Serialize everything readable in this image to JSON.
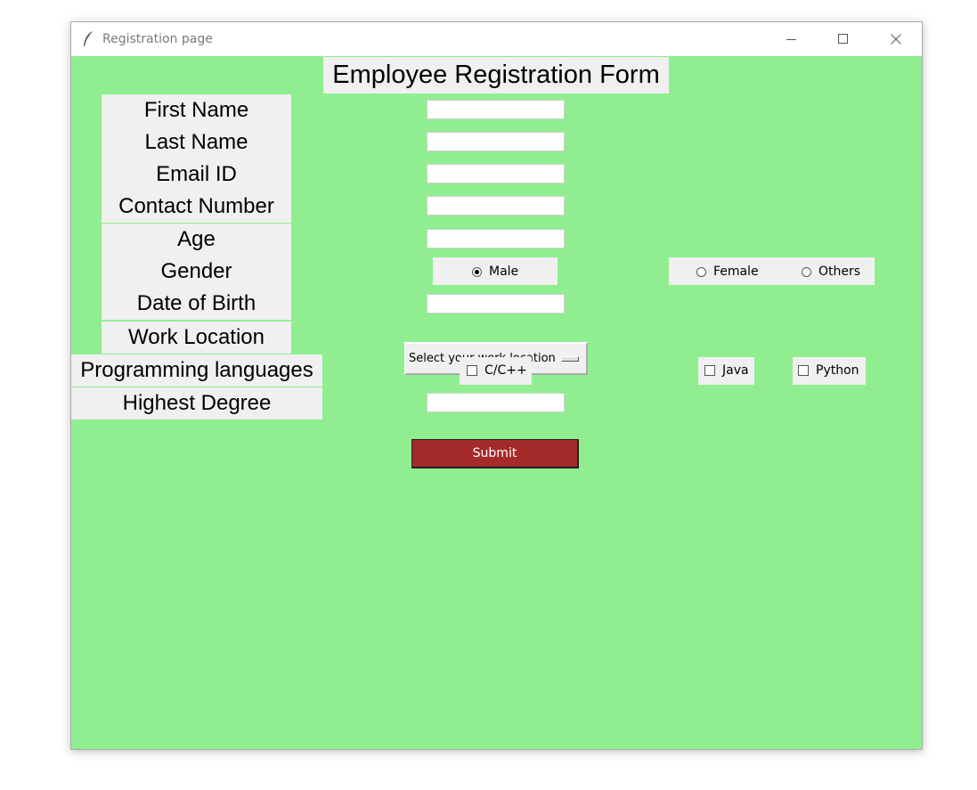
{
  "window": {
    "title": "Registration page",
    "icon": "feather-icon",
    "controls": [
      "minimize-icon",
      "maximize-icon",
      "close-icon"
    ]
  },
  "form": {
    "heading": "Employee Registration Form",
    "labels": {
      "first_name": "First Name",
      "last_name": "Last Name",
      "email": "Email ID",
      "contact": "Contact Number",
      "age": "Age",
      "gender": "Gender",
      "dob": "Date of Birth",
      "work_location": "Work Location",
      "programming": "Programming languages",
      "degree": "Highest Degree"
    },
    "values": {
      "first_name": "",
      "last_name": "",
      "email": "",
      "contact": "",
      "age": "",
      "dob": "",
      "degree": ""
    },
    "gender_options": {
      "male": "Male",
      "female": "Female",
      "others": "Others",
      "selected": "male"
    },
    "work_location_placeholder": "Select your work location",
    "languages": {
      "c_cpp": "C/C++",
      "java": "Java",
      "python": "Python"
    },
    "submit_label": "Submit"
  },
  "colors": {
    "background": "#90ee90",
    "label_bg": "#f0f0f0",
    "submit_bg": "#a52a2a",
    "submit_text": "#ffffff"
  }
}
